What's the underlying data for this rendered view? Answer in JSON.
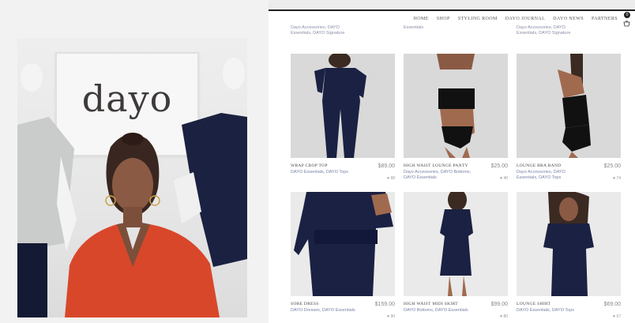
{
  "video": {
    "brand_logo": "dayo"
  },
  "site": {
    "nav": [
      "Home",
      "Shop",
      "Styling Room",
      "Dayo Journal",
      "Dayo News",
      "Partners"
    ],
    "cart_count": "0",
    "prev_row": [
      {
        "cats": "Dayo Accessories, DAYO Essentials, DAYO Signature"
      },
      {
        "cats": "Essentials"
      },
      {
        "cats": "Dayo Accessories, DAYO Essentials, DAYO Signature"
      }
    ],
    "products": [
      {
        "name": "Wrap Crop Top",
        "price": "$89.00",
        "cats": "DAYO Essentials, DAYO Tops",
        "likes": "68"
      },
      {
        "name": "High Waist Lounge Panty",
        "price": "$25.00",
        "cats": "Dayo Accessories, DAYO Bottoms, DAYO Essentials",
        "likes": "40"
      },
      {
        "name": "Lounge Bra Band",
        "price": "$25.00",
        "cats": "Dayo Accessories, DAYO Essentials, DAYO Tops",
        "likes": "74"
      },
      {
        "name": "Sore Dress",
        "price": "$159.00",
        "cats": "DAYO Dresses, DAYO Essentials",
        "likes": "90"
      },
      {
        "name": "High Waist Midi Skirt",
        "price": "$99.00",
        "cats": "DAYO Bottoms, DAYO Essentials",
        "likes": "80"
      },
      {
        "name": "Lounge Shirt",
        "price": "$69.00",
        "cats": "DAYO Essentials, DAYO Tops",
        "likes": "57"
      }
    ]
  }
}
